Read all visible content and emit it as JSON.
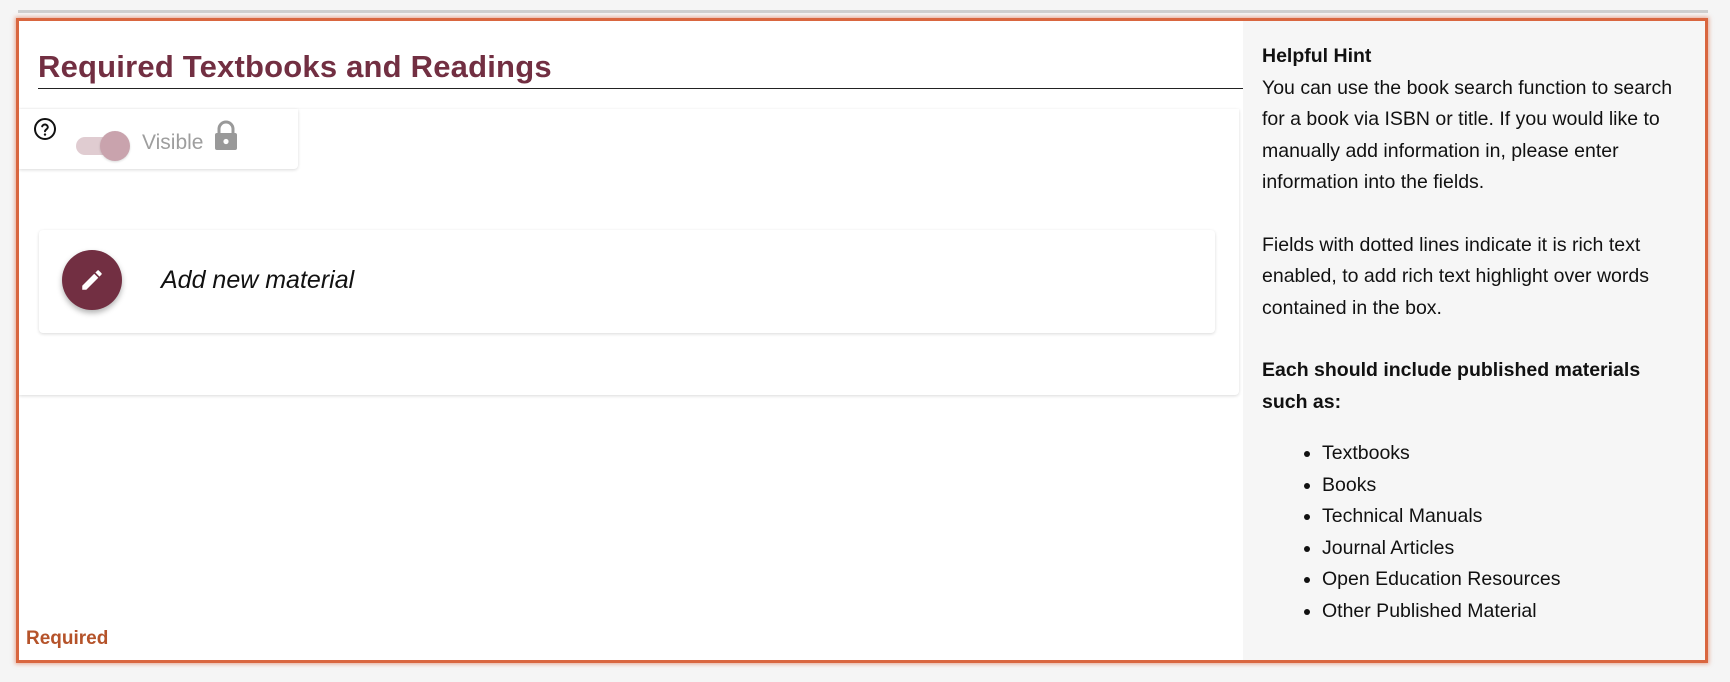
{
  "section": {
    "title": "Required Textbooks and Readings",
    "visibility_label": "Visible",
    "visibility_on": true,
    "visibility_locked": true,
    "add_material_label": "Add new material",
    "required_label": "Required"
  },
  "hint": {
    "title": "Helpful Hint",
    "para1": "You can use the book search function to search for a book via ISBN or title. If you would like to manually add information in, please enter information into the fields.",
    "para2": "Fields with dotted lines indicate it is rich text enabled, to add rich text highlight over words contained in the box.",
    "para3": "Each should include published materials such as:",
    "items": [
      "Textbooks",
      "Books",
      "Technical Manuals",
      "Journal Articles",
      "Open Education Resources",
      "Other Published Material"
    ]
  },
  "colors": {
    "brand": "#722f42",
    "frame_border": "#d9663f",
    "required_text": "#b5532a",
    "toggle_track": "#e0ccd1",
    "toggle_thumb": "#c9a3ad"
  },
  "icons": {
    "help": "help-circle-icon",
    "lock": "lock-icon",
    "edit": "pencil-icon"
  }
}
